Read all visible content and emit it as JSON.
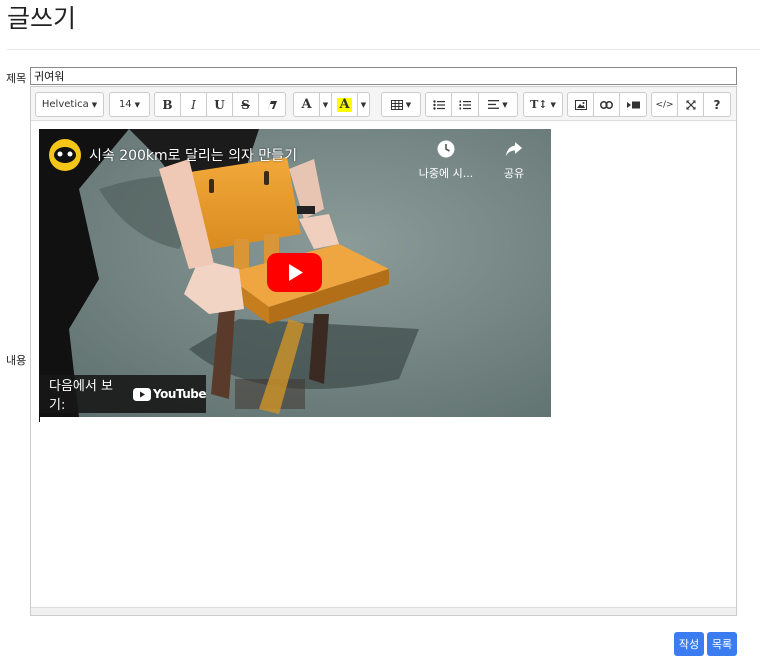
{
  "page": {
    "title": "글쓰기"
  },
  "form": {
    "subject_label": "제목",
    "subject_value": "귀여워",
    "content_label": "내용"
  },
  "toolbar": {
    "font_family": "Helvetica",
    "font_size": "14",
    "bold": "B",
    "italic": "I",
    "underline": "U",
    "strikethrough": "S",
    "color": "A",
    "highlight": "A",
    "line_height": "T↕",
    "help": "?",
    "code_view": "</>",
    "icons": [
      "bold-icon",
      "italic-icon",
      "underline-icon",
      "strikethrough-icon",
      "eraser-icon",
      "font-color-icon",
      "highlight-icon",
      "table-icon",
      "unordered-list-icon",
      "ordered-list-icon",
      "align-icon",
      "line-height-icon",
      "image-icon",
      "link-icon",
      "video-icon",
      "code-view-icon",
      "fullscreen-icon",
      "help-icon"
    ]
  },
  "video": {
    "title": "시속 200km로 달리는 의자 만들기",
    "watch_later": "나중에 시...",
    "share": "공유",
    "watch_on": "다음에서 보기:",
    "youtube": "YouTube"
  },
  "buttons": {
    "submit": "작성",
    "list": "목록"
  },
  "colors": {
    "primary": "#3b7df0",
    "youtube_red": "#ff0000",
    "highlight_yellow": "#ffff00"
  }
}
